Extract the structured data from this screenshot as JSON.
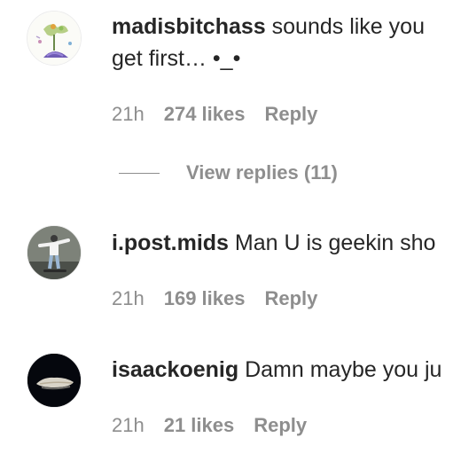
{
  "comments": [
    {
      "username": "madisbitchass",
      "text_line1": "sounds like you",
      "text_line2": "get first… •_•",
      "time": "21h",
      "likes": "274 likes",
      "reply": "Reply"
    },
    {
      "username": "i.post.mids",
      "text_line1": "Man U is geekin sho",
      "time": "21h",
      "likes": "169 likes",
      "reply": "Reply"
    },
    {
      "username": "isaackoenig",
      "text_line1": "Damn maybe you ju",
      "time": "21h",
      "likes": "21 likes",
      "reply": "Reply"
    }
  ],
  "view_replies_label": "View replies (11)",
  "colors": {
    "text_primary": "#262626",
    "text_secondary": "#8e8e8e"
  }
}
